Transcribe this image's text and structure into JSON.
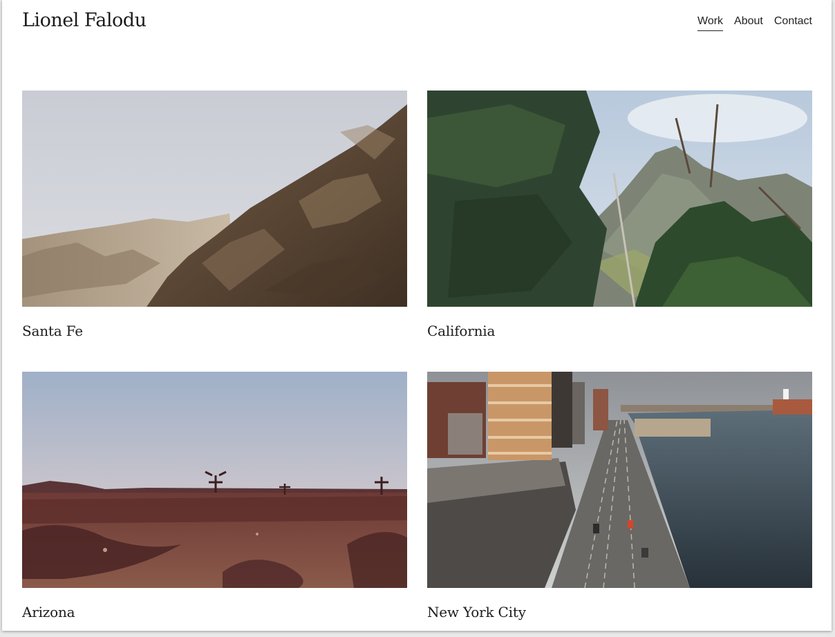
{
  "site": {
    "title": "Lionel Falodu"
  },
  "nav": {
    "items": [
      {
        "label": "Work",
        "active": true
      },
      {
        "label": "About",
        "active": false
      },
      {
        "label": "Contact",
        "active": false
      }
    ]
  },
  "gallery": {
    "items": [
      {
        "caption": "Santa Fe"
      },
      {
        "caption": "California"
      },
      {
        "caption": "Arizona"
      },
      {
        "caption": "New York City"
      }
    ]
  },
  "colors": {
    "text": "#1c1c1c",
    "background": "#ffffff"
  }
}
